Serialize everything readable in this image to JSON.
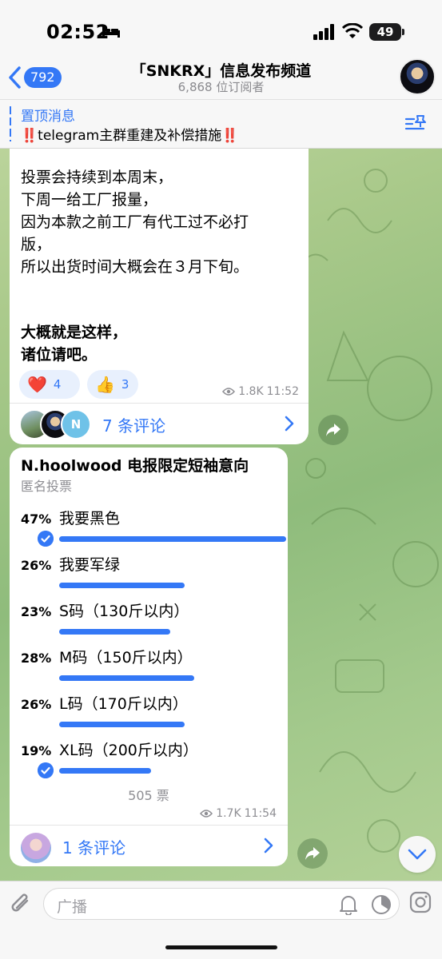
{
  "status_bar": {
    "time": "02:52",
    "battery": "49"
  },
  "header": {
    "back_count": "792",
    "title": "「SNKRX」信息发布频道",
    "subtitle": "6,868 位订阅者"
  },
  "pinned": {
    "label": "置顶消息",
    "text_prefix": "‼️",
    "text": "telegram主群重建及补偿措施",
    "text_suffix": "‼️"
  },
  "message1": {
    "lines": [
      "投票会持续到本周末，",
      "下周一给工厂报量，",
      "因为本款之前工厂有代工过不必打",
      "版，",
      "所以出货时间大概会在３月下旬。"
    ],
    "bold_lines": [
      "大概就是这样，",
      "诸位请吧。"
    ],
    "reactions": [
      {
        "emoji": "❤️",
        "count": "4"
      },
      {
        "emoji": "👍",
        "count": "3"
      }
    ],
    "views": "1.8K",
    "time": "11:52",
    "comments_label": "7 条评论",
    "avatar_letter": "N"
  },
  "poll": {
    "title": "N.hoolwood 电报限定短袖意向",
    "subtitle": "匿名投票",
    "options": [
      {
        "percent": "47%",
        "label": "我要黑色",
        "fraction": 0.47,
        "checked": true
      },
      {
        "percent": "26%",
        "label": "我要军绿",
        "fraction": 0.26,
        "checked": false
      },
      {
        "percent": "23%",
        "label": "S码（130斤以内）",
        "fraction": 0.23,
        "checked": false
      },
      {
        "percent": "28%",
        "label": "M码（150斤以内）",
        "fraction": 0.28,
        "checked": false
      },
      {
        "percent": "26%",
        "label": "L码（170斤以内）",
        "fraction": 0.26,
        "checked": false
      },
      {
        "percent": "19%",
        "label": "XL码（200斤以内）",
        "fraction": 0.19,
        "checked": true
      }
    ],
    "votes": "505 票",
    "views": "1.7K",
    "time": "11:54",
    "comments_label": "1 条评论"
  },
  "input": {
    "placeholder": "广播"
  },
  "colors": {
    "accent": "#3478f6",
    "bubble": "#ffffff",
    "background": "#a9c98a"
  }
}
